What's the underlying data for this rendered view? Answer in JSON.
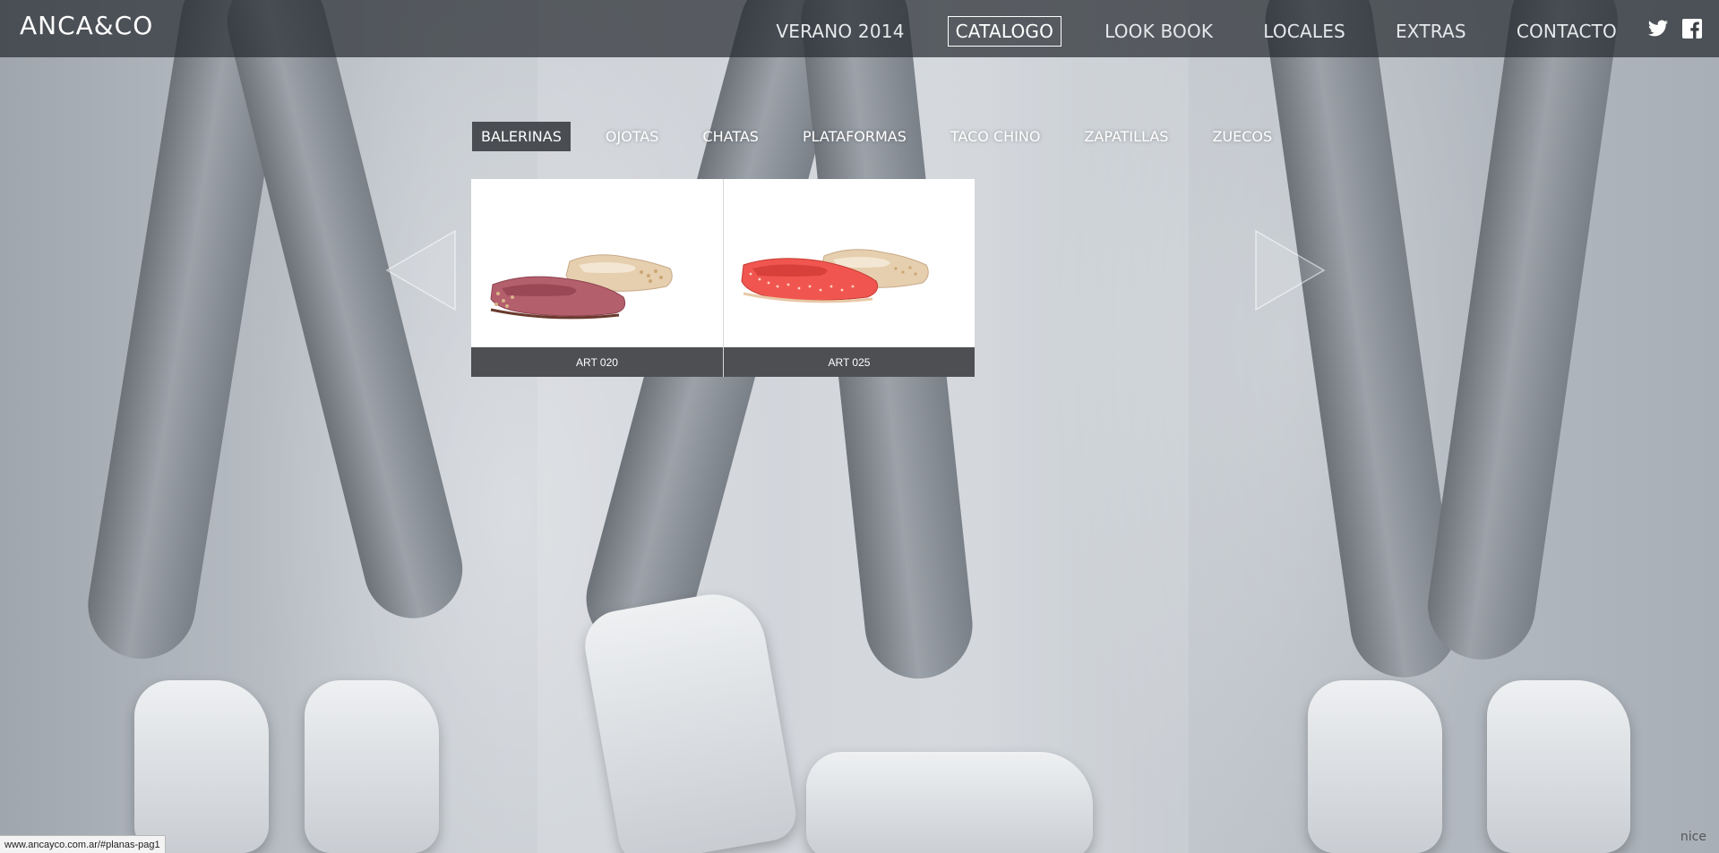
{
  "brand": {
    "logo": "ANCA&CO"
  },
  "nav": {
    "items": [
      {
        "label": "VERANO 2014",
        "active": false
      },
      {
        "label": "CATALOGO",
        "active": true
      },
      {
        "label": "LOOK BOOK",
        "active": false
      },
      {
        "label": "LOCALES",
        "active": false
      },
      {
        "label": "EXTRAS",
        "active": false
      },
      {
        "label": "CONTACTO",
        "active": false
      }
    ],
    "social": [
      "twitter-icon",
      "facebook-icon"
    ]
  },
  "categories": [
    {
      "label": "BALERINAS",
      "active": true
    },
    {
      "label": "OJOTAS",
      "active": false
    },
    {
      "label": "CHATAS",
      "active": false
    },
    {
      "label": "PLATAFORMAS",
      "active": false
    },
    {
      "label": "TACO CHINO",
      "active": false
    },
    {
      "label": "ZAPATILLAS",
      "active": false
    },
    {
      "label": "ZUECOS",
      "active": false
    }
  ],
  "products": [
    {
      "label": "ART 020",
      "colors": [
        "#b45f6c",
        "#e6cfae"
      ]
    },
    {
      "label": "ART 025",
      "colors": [
        "#f0564f",
        "#e6cfae"
      ]
    }
  ],
  "status_url": "www.ancayco.com.ar/#planas-pag1",
  "watermark": "nice",
  "colors": {
    "header_bg": "#2c3036",
    "active_tab": "#4a4d52",
    "label_bg": "#4d4f53"
  }
}
